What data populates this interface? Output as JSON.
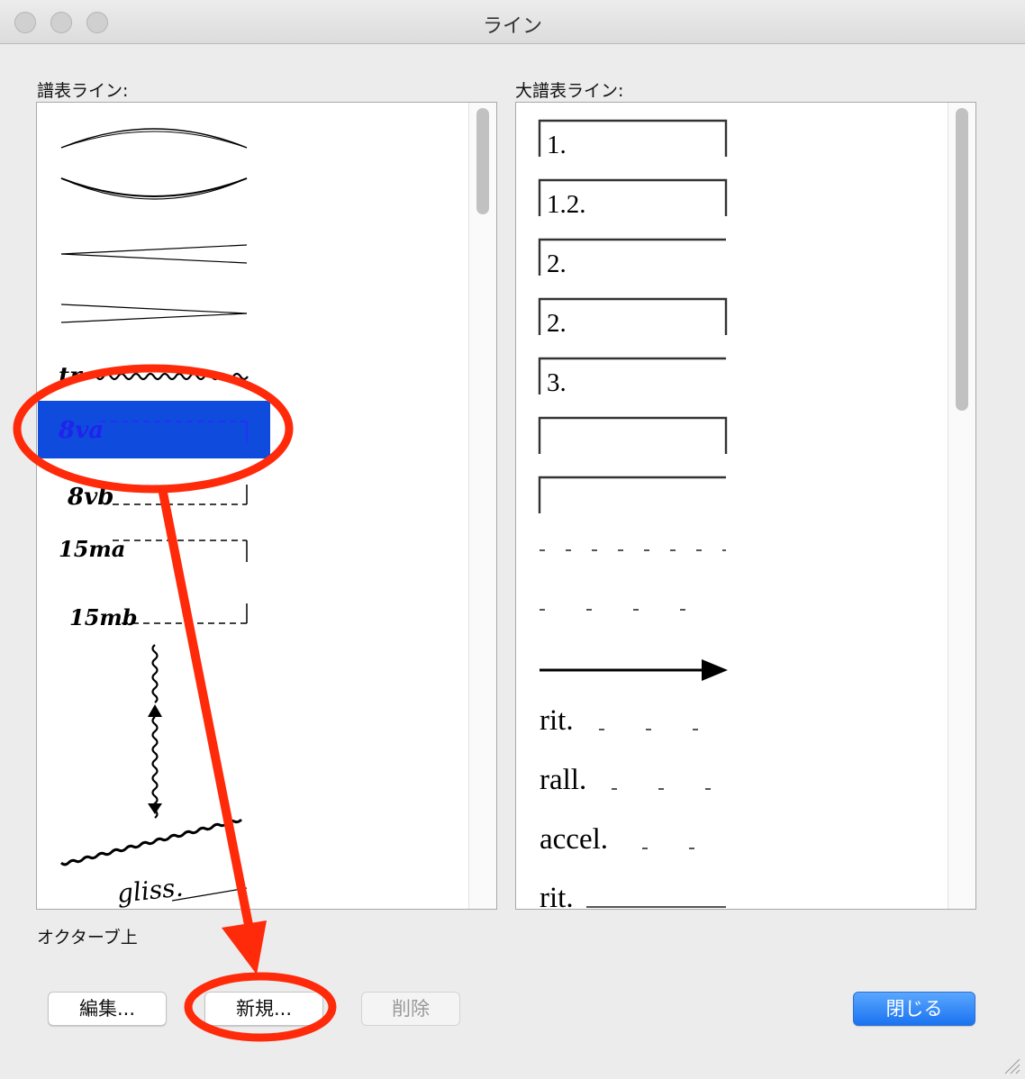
{
  "window": {
    "title": "ライン"
  },
  "staff_lines": {
    "label": "譜表ライン:",
    "items": [
      {
        "type": "slur-over"
      },
      {
        "type": "slur-under"
      },
      {
        "type": "crescendo"
      },
      {
        "type": "decrescendo"
      },
      {
        "type": "trill",
        "text": "tr"
      },
      {
        "type": "octave",
        "text": "8va",
        "selected": true
      },
      {
        "type": "octave",
        "text": "8vb"
      },
      {
        "type": "octave",
        "text": "15ma"
      },
      {
        "type": "octave",
        "text": "15mb"
      },
      {
        "type": "arpeggio-up"
      },
      {
        "type": "arpeggio-down"
      },
      {
        "type": "trill-wave"
      },
      {
        "type": "gliss",
        "text": "gliss."
      }
    ]
  },
  "system_lines": {
    "label": "大譜表ライン:",
    "items": [
      {
        "type": "ending",
        "text": "1."
      },
      {
        "type": "ending",
        "text": "1.2."
      },
      {
        "type": "ending-open",
        "text": "2."
      },
      {
        "type": "ending",
        "text": "2."
      },
      {
        "type": "ending-open",
        "text": "3."
      },
      {
        "type": "ending",
        "text": ""
      },
      {
        "type": "ending-open",
        "text": ""
      },
      {
        "type": "dashed"
      },
      {
        "type": "dashed-wide"
      },
      {
        "type": "arrow"
      },
      {
        "type": "tempo-dashed",
        "text": "rit."
      },
      {
        "type": "tempo-dashed",
        "text": "rall."
      },
      {
        "type": "tempo-dashed",
        "text": "accel."
      },
      {
        "type": "tempo-line",
        "text": "rit."
      }
    ]
  },
  "selection_name": "オクターブ上",
  "buttons": {
    "edit": "編集...",
    "new": "新規...",
    "delete": "削除",
    "close": "閉じる"
  },
  "colors": {
    "selection": "#0f4bdc",
    "annotation": "#ff2a0a",
    "primary_button": "#1a73f0"
  }
}
